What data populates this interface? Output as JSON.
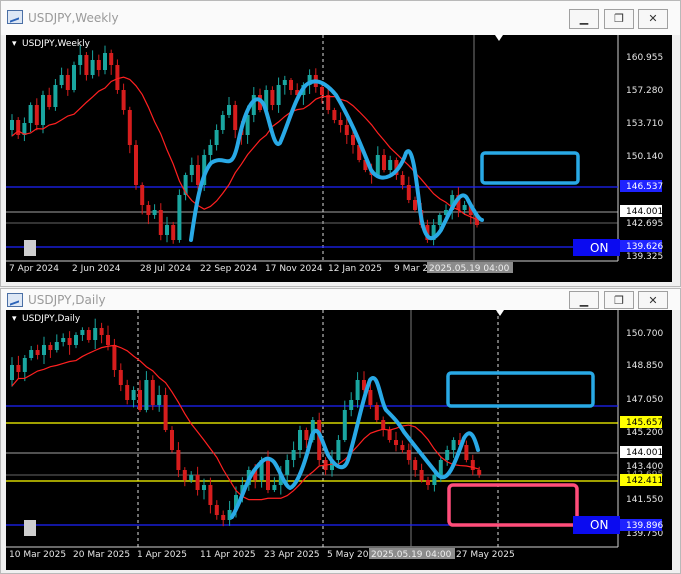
{
  "weekly": {
    "window_title": "USDJPY,Weekly",
    "chart_label": "USDJPY,Weekly",
    "price_labels": [
      "160.955",
      "157.280",
      "153.710",
      "150.140",
      "146.537",
      "144.001",
      "142.695",
      "139.325"
    ],
    "on_level_label": "139.626",
    "time_labels": [
      "7 Apr 2024",
      "2 Jun 2024",
      "28 Jul 2024",
      "22 Sep 2024",
      "17 Nov 2024",
      "12 Jan 2025",
      "9 Mar 202"
    ],
    "cursor_time": "2025.05.19 04:00",
    "on_label": "ON"
  },
  "daily": {
    "window_title": "USDJPY,Daily",
    "chart_label": "USDJPY,Daily",
    "price_labels": [
      "150.700",
      "148.850",
      "147.050",
      "145.200",
      "143.400",
      "141.550",
      "139.750"
    ],
    "on_level_label": "139.896",
    "yellow_upper_label": "145.657",
    "yellow_lower_label": "142.411",
    "grey_label": "142.695",
    "current_label": "144.001",
    "time_labels": [
      "10 Mar 2025",
      "20 Mar 2025",
      "1 Apr 2025",
      "11 Apr 2025",
      "23 Apr 2025",
      "5 May 20",
      "27 May 2025"
    ],
    "cursor_time": "2025.05.19 04:00",
    "on_label": "ON"
  },
  "colors": {
    "bull": "#1aa6a0",
    "bear": "#d61d1d",
    "ma": "#ff2020",
    "blue_line": "#1e23ff",
    "yellow_line": "#ffff00",
    "pattern": "#29a9e6",
    "box_blue": "#29a9e6",
    "box_pink": "#ff4d7a",
    "on_bg": "#0b0bf0"
  }
}
